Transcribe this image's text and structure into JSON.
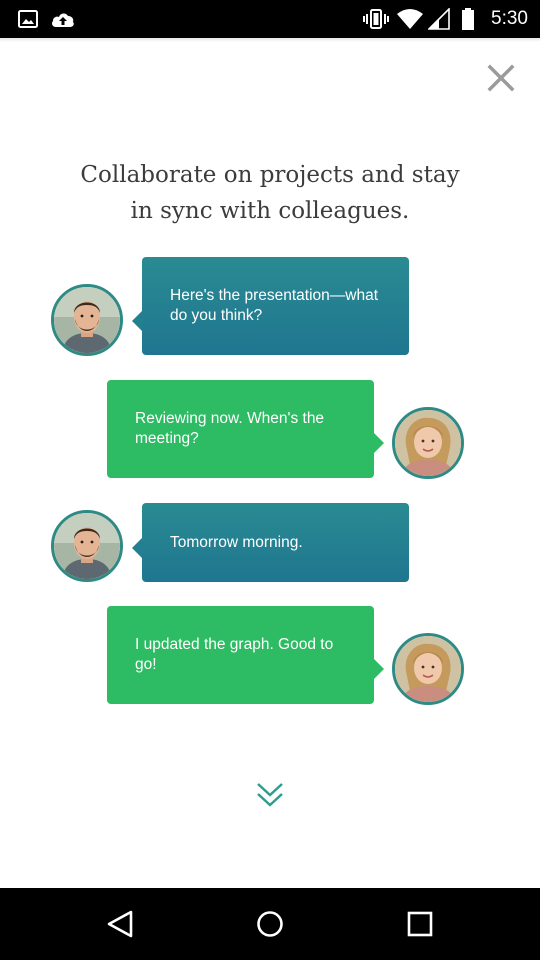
{
  "status_bar": {
    "time": "5:30",
    "left_icons": [
      "image-icon",
      "cloud-upload-icon"
    ],
    "right_icons": [
      "vibrate-icon",
      "wifi-icon",
      "signal-icon",
      "battery-icon"
    ]
  },
  "onboarding": {
    "heading_line1": "Collaborate on projects and stay",
    "heading_line2": "in sync with colleagues.",
    "messages": [
      {
        "sender": "colleague-man",
        "text": "Here's the presentation—what do you think?",
        "color": "#237f8e"
      },
      {
        "sender": "colleague-woman",
        "text": "Reviewing now. When's the meeting?",
        "color": "#2dbb63"
      },
      {
        "sender": "colleague-man",
        "text": "Tomorrow morning.",
        "color": "#237f8e"
      },
      {
        "sender": "colleague-woman",
        "text": "I updated the graph. Good to go!",
        "color": "#2dbb63"
      }
    ]
  },
  "colors": {
    "teal": "#237f8e",
    "green": "#2dbb63",
    "avatar_ring": "#2f8a86",
    "heading_text": "#3c3c3c",
    "chevron": "#2a9d8f"
  },
  "icons": {
    "close": "close-icon",
    "scroll_down": "double-chevron-down-icon",
    "nav_back": "back-triangle-icon",
    "nav_home": "home-circle-icon",
    "nav_recents": "recents-square-icon"
  }
}
